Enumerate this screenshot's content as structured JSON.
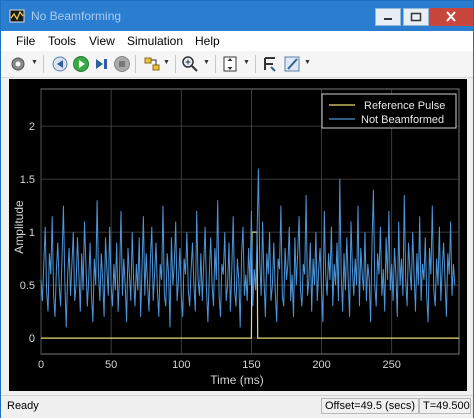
{
  "window": {
    "title": "No Beamforming"
  },
  "menu": {
    "items": [
      "File",
      "Tools",
      "View",
      "Simulation",
      "Help"
    ]
  },
  "toolbar": {
    "icons": [
      "gear-icon",
      "step-back-icon",
      "run-icon",
      "step-forward-icon",
      "stop-icon",
      "highlight-block-icon",
      "zoom-icon",
      "scale-axes-icon",
      "measure-cursor-icon",
      "style-icon"
    ]
  },
  "colors": {
    "reference": "#e6dc6e",
    "signal": "#4d95d9",
    "background": "#000000",
    "grid": "#4a4a4a"
  },
  "chart_data": {
    "type": "line",
    "xlabel": "Time (ms)",
    "ylabel": "Amplitude",
    "xlim": [
      0,
      298
    ],
    "ylim": [
      -0.15,
      2.35
    ],
    "xticks": [
      0,
      50,
      100,
      150,
      200,
      250
    ],
    "yticks": [
      0,
      0.5,
      1,
      1.5,
      2
    ],
    "ytick_labels": [
      "0",
      "0.5",
      "1",
      "1.5",
      "2"
    ],
    "grid": true,
    "legend_position": "top-right",
    "series": [
      {
        "name": "Reference Pulse",
        "x": [
          0,
          150,
          150.5,
          154,
          154.5,
          298
        ],
        "y": [
          0,
          0,
          1,
          1,
          0,
          0
        ]
      },
      {
        "name": "Not Beamformed",
        "x_start": 0,
        "x_step": 1,
        "y": [
          0.55,
          0.35,
          0.7,
          1.05,
          0.45,
          0.25,
          0.8,
          0.6,
          1.15,
          0.4,
          0.2,
          0.65,
          0.9,
          0.5,
          0.3,
          0.75,
          1.25,
          0.55,
          0.1,
          0.6,
          0.85,
          0.4,
          0.7,
          1.0,
          0.35,
          0.5,
          0.95,
          0.6,
          0.25,
          0.8,
          0.45,
          1.1,
          0.7,
          0.3,
          0.55,
          0.9,
          0.4,
          0.15,
          0.75,
          0.5,
          1.3,
          0.6,
          0.35,
          0.8,
          0.55,
          0.2,
          0.95,
          0.65,
          0.4,
          1.05,
          0.5,
          0.3,
          0.7,
          0.45,
          0.9,
          0.25,
          0.6,
          1.2,
          0.4,
          0.75,
          0.5,
          0.15,
          0.85,
          0.6,
          0.35,
          1.0,
          0.55,
          0.3,
          0.7,
          0.45,
          0.95,
          0.2,
          0.65,
          1.15,
          0.4,
          0.8,
          0.5,
          0.25,
          0.75,
          1.05,
          0.35,
          0.6,
          0.9,
          0.45,
          0.2,
          0.7,
          0.55,
          1.25,
          0.4,
          0.3,
          0.8,
          0.6,
          0.1,
          0.95,
          0.5,
          0.7,
          1.1,
          0.35,
          0.55,
          0.85,
          0.4,
          0.2,
          0.75,
          0.6,
          1.0,
          0.45,
          0.3,
          0.65,
          0.9,
          0.5,
          0.25,
          1.2,
          0.55,
          0.4,
          0.8,
          0.35,
          0.7,
          1.05,
          0.45,
          0.15,
          0.6,
          0.95,
          0.5,
          0.3,
          0.85,
          0.55,
          1.3,
          0.4,
          0.2,
          0.7,
          0.6,
          1.0,
          0.35,
          0.5,
          0.9,
          0.25,
          0.65,
          1.15,
          0.45,
          0.3,
          0.75,
          0.55,
          0.1,
          0.8,
          1.05,
          0.4,
          0.6,
          0.35,
          0.85,
          0.5,
          1.2,
          0.3,
          0.65,
          0.45,
          0.95,
          1.6,
          0.7,
          0.4,
          1.1,
          0.55,
          0.2,
          0.8,
          0.6,
          1.0,
          0.35,
          0.5,
          0.9,
          0.45,
          0.15,
          0.75,
          0.65,
          1.25,
          0.4,
          0.3,
          0.85,
          0.55,
          0.7,
          1.05,
          0.35,
          0.6,
          0.2,
          0.95,
          0.5,
          0.8,
          1.15,
          0.45,
          0.3,
          0.7,
          0.6,
          1.35,
          0.4,
          0.55,
          0.9,
          0.25,
          0.75,
          0.5,
          1.0,
          0.35,
          0.65,
          0.85,
          0.45,
          0.15,
          1.2,
          0.6,
          0.4,
          0.8,
          0.55,
          1.05,
          0.3,
          0.7,
          0.5,
          0.9,
          0.35,
          1.5,
          0.6,
          0.25,
          0.8,
          0.45,
          0.95,
          0.55,
          0.2,
          1.1,
          0.65,
          0.4,
          0.75,
          0.5,
          1.25,
          0.3,
          0.85,
          0.6,
          0.45,
          1.0,
          0.35,
          0.7,
          0.55,
          0.15,
          0.9,
          1.4,
          0.5,
          0.3,
          0.8,
          0.6,
          1.05,
          0.4,
          0.65,
          0.25,
          0.95,
          0.55,
          1.2,
          0.45,
          0.7,
          0.35,
          0.85,
          0.6,
          0.2,
          1.1,
          0.5,
          0.75,
          0.4,
          1.35,
          0.55,
          0.3,
          0.9,
          0.65,
          0.45,
          1.0,
          0.6,
          0.25,
          0.8,
          0.5,
          1.15,
          0.35,
          0.7,
          0.55,
          0.95,
          0.4,
          0.15,
          0.85,
          0.6,
          1.25,
          0.45,
          0.3,
          0.75,
          0.5,
          1.05,
          0.35,
          0.65,
          0.9,
          0.55,
          0.2,
          0.8,
          0.6,
          1.1,
          0.4,
          0.7,
          0.5
        ]
      }
    ]
  },
  "status": {
    "ready": "Ready",
    "offset": "Offset=49.5 (secs)",
    "time": "T=49.500"
  }
}
